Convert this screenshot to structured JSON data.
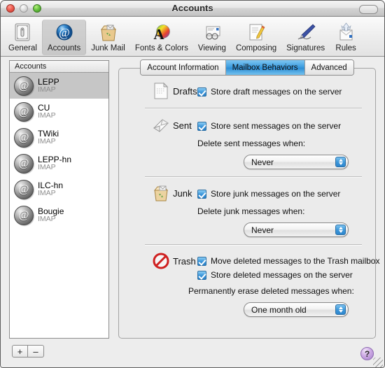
{
  "window": {
    "title": "Accounts",
    "traffic_lights": [
      "close-button",
      "minimize-button",
      "zoom-button"
    ],
    "help_label": "?"
  },
  "toolbar": {
    "items": [
      {
        "label": "General",
        "icon": "general-icon",
        "selected": false
      },
      {
        "label": "Accounts",
        "icon": "accounts-at-icon",
        "selected": true
      },
      {
        "label": "Junk Mail",
        "icon": "junk-mail-bag-icon",
        "selected": false
      },
      {
        "label": "Fonts & Colors",
        "icon": "fonts-colors-icon",
        "selected": false
      },
      {
        "label": "Viewing",
        "icon": "viewing-glasses-icon",
        "selected": false
      },
      {
        "label": "Composing",
        "icon": "composing-pencil-icon",
        "selected": false
      },
      {
        "label": "Signatures",
        "icon": "signatures-pen-icon",
        "selected": false
      },
      {
        "label": "Rules",
        "icon": "rules-icon",
        "selected": false
      }
    ]
  },
  "sidebar": {
    "header": "Accounts",
    "accounts": [
      {
        "name": "LEPP",
        "type": "IMAP",
        "selected": true
      },
      {
        "name": "CU",
        "type": "IMAP",
        "selected": false
      },
      {
        "name": "TWiki",
        "type": "IMAP",
        "selected": false
      },
      {
        "name": "LEPP-hn",
        "type": "IMAP",
        "selected": false
      },
      {
        "name": "ILC-hn",
        "type": "IMAP",
        "selected": false
      },
      {
        "name": "Bougie",
        "type": "IMAP",
        "selected": false
      }
    ],
    "add_label": "+",
    "remove_label": "–"
  },
  "tabs": [
    {
      "label": "Account Information",
      "active": false
    },
    {
      "label": "Mailbox Behaviors",
      "active": true
    },
    {
      "label": "Advanced",
      "active": false
    }
  ],
  "sections": {
    "drafts": {
      "title": "Drafts",
      "icon": "drafts-document-icon",
      "checkbox_label": "Store draft messages on the server",
      "checked": true
    },
    "sent": {
      "title": "Sent",
      "icon": "sent-envelope-icon",
      "checkbox_label": "Store sent messages on the server",
      "checked": true,
      "subtitle": "Delete sent messages when:",
      "popup_value": "Never"
    },
    "junk": {
      "title": "Junk",
      "icon": "junk-bag-icon",
      "checkbox_label": "Store junk messages on the server",
      "checked": true,
      "subtitle": "Delete junk messages when:",
      "popup_value": "Never"
    },
    "trash": {
      "title": "Trash",
      "icon": "trash-prohibited-icon",
      "checkbox_label_1": "Move deleted messages to the Trash mailbox",
      "checked_1": true,
      "checkbox_label_2": "Store deleted messages on the server",
      "checked_2": true,
      "subtitle": "Permanently erase deleted messages when:",
      "popup_value": "One month old"
    }
  },
  "colors": {
    "accent_blue": "#3d97db",
    "selected_tab": "#3f9fe0",
    "sidebar_selection": "#c6c6c6",
    "help_purple": "#cdaae4"
  }
}
